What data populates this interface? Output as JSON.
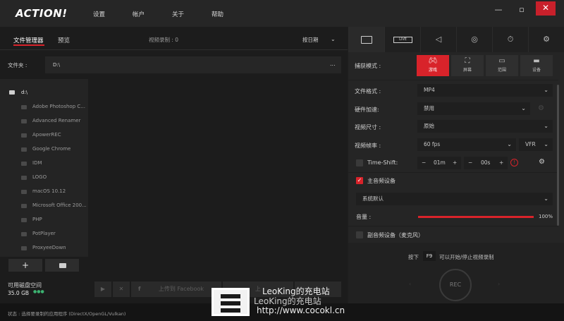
{
  "app": {
    "logo": "ACTION!"
  },
  "menu": [
    "设置",
    "帐户",
    "关于",
    "帮助"
  ],
  "window_controls": {
    "minimize": "—",
    "restore": "▫",
    "close": "✕"
  },
  "left": {
    "tabs": {
      "files": "文件管理器",
      "preview": "预览"
    },
    "recording_count": "视频录制 : 0",
    "sort": "按日期",
    "folder_label": "文件夹 :",
    "folder_path": "D:\\",
    "folder_more": "...",
    "tree_root": "d:\\",
    "tree_items": [
      "Adobe Photoshop C...",
      "Advanced Renamer",
      "ApowerREC",
      "Google Chrome",
      "IDM",
      "LOGO",
      "macOS 10.12",
      "Microsoft Office 200...",
      "PHP",
      "PotPlayer",
      "ProxyeeDown"
    ],
    "add_button": "+",
    "disk_label": "可用磁盘空间",
    "disk_value": "35.0 GB",
    "disk_dots": "●●●",
    "upload_facebook": "上传到 Facebook",
    "upload_other": "上"
  },
  "status": "状态 :  选择要录制的应用程序 (DirectX/OpenGL/Vulkan)",
  "right": {
    "tabs": [
      "video",
      "live",
      "audio",
      "camera",
      "timer",
      "settings"
    ],
    "live_label": "LIVE",
    "capture_mode_label": "捕获模式 :",
    "modes": [
      {
        "label": "游戏",
        "icon": "gamepad-icon",
        "active": true
      },
      {
        "label": "屏幕",
        "icon": "screen-icon",
        "active": false
      },
      {
        "label": "范围",
        "icon": "region-icon",
        "active": false
      },
      {
        "label": "设备",
        "icon": "device-icon",
        "active": false
      }
    ],
    "format_label": "文件格式 :",
    "format_value": "MP4",
    "hwaccel_label": "硬件加速:",
    "hwaccel_value": "禁用",
    "size_label": "视频尺寸 :",
    "size_value": "原始",
    "fps_label": "视频帧率 :",
    "fps_value": "60 fps",
    "fps_mode": "VFR",
    "timeshift_label": "Time-Shift:",
    "timeshift_minutes": "01m",
    "timeshift_seconds": "00s",
    "main_audio_label": "主音频设备",
    "main_audio_value": "系统默认",
    "volume_label": "音量 :",
    "volume_value": "100%",
    "volume_fraction": 1.0,
    "secondary_audio_label": "副音频设备（麦克风）",
    "hotkey_prefix": "按下",
    "hotkey": "F9",
    "hotkey_suffix": "可以开始/停止视频录制",
    "rec_label": "REC"
  },
  "watermark": {
    "line1": "LeoKing的充电站",
    "line2": "LeoKing的充电站",
    "line3": "http://www.cocokl.cn"
  },
  "colors": {
    "accent": "#d8232a"
  }
}
